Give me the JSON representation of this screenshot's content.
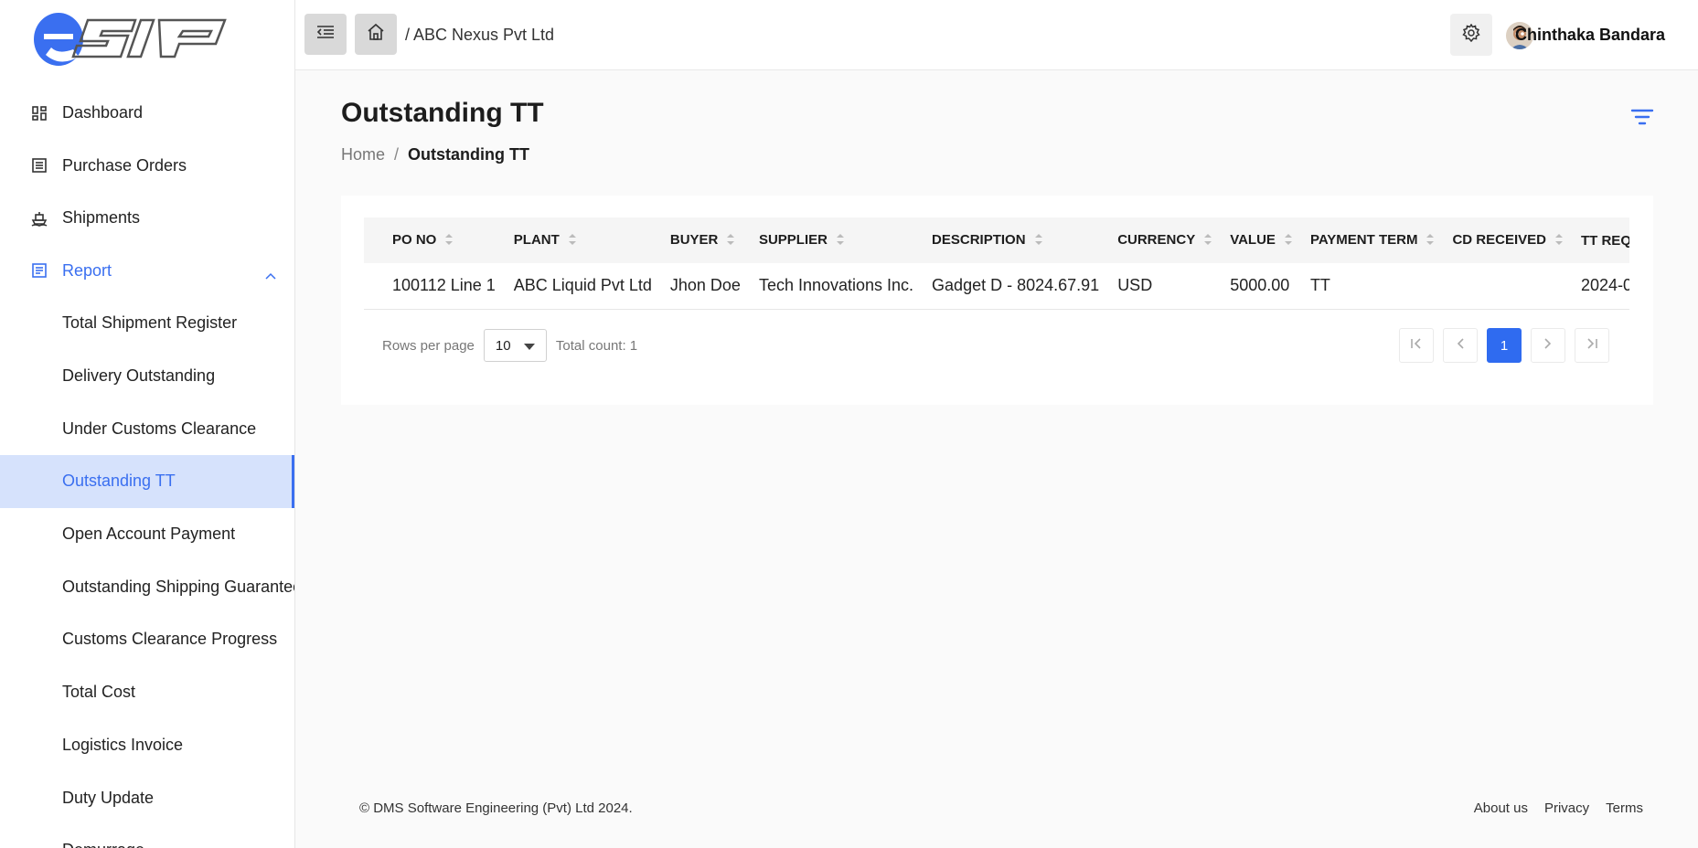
{
  "brand": {
    "logo_text": "eSIP",
    "accent": "#3a6ff0"
  },
  "header": {
    "company": "/ ABC Nexus Pvt Ltd",
    "user_name": "Chinthaka Bandara"
  },
  "sidebar": {
    "items": [
      {
        "label": "Dashboard",
        "icon": "dashboard-icon"
      },
      {
        "label": "Purchase Orders",
        "icon": "list-icon"
      },
      {
        "label": "Shipments",
        "icon": "ship-icon"
      },
      {
        "label": "Report",
        "icon": "report-icon",
        "expanded": true
      }
    ],
    "report_items": [
      "Total Shipment Register",
      "Delivery Outstanding",
      "Under Customs Clearance",
      "Outstanding TT",
      "Open Account Payment",
      "Outstanding Shipping Guarantee",
      "Customs Clearance Progress",
      "Total Cost",
      "Logistics Invoice",
      "Duty Update",
      "Demurrage"
    ],
    "active_item": "Outstanding TT"
  },
  "page": {
    "title": "Outstanding TT",
    "breadcrumb_home": "Home",
    "breadcrumb_sep": "/",
    "breadcrumb_current": "Outstanding TT"
  },
  "table": {
    "columns": [
      "PO NO",
      "PLANT",
      "BUYER",
      "SUPPLIER",
      "DESCRIPTION",
      "CURRENCY",
      "VALUE",
      "PAYMENT TERM",
      "CD RECEIVED",
      "TT REQ"
    ],
    "rows": [
      [
        "100112 Line 1",
        "ABC Liquid Pvt Ltd",
        "Jhon Doe",
        "Tech Innovations Inc.",
        "Gadget D - 8024.67.91",
        "USD",
        "5000.00",
        "TT",
        "",
        "2024-0"
      ]
    ]
  },
  "pagination": {
    "rows_per_page_label": "Rows per page",
    "rows_per_page": "10",
    "total_count": "Total count: 1",
    "current_page": "1"
  },
  "footer": {
    "copyright": "© DMS Software Engineering (Pvt) Ltd 2024.",
    "links": [
      "About us",
      "Privacy",
      "Terms"
    ]
  }
}
